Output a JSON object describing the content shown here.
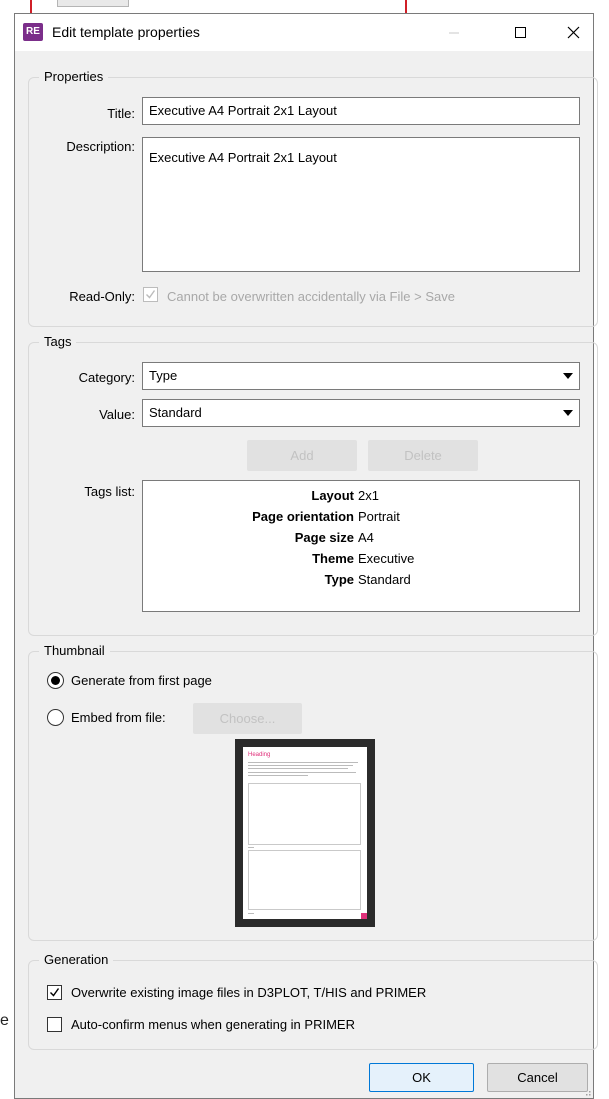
{
  "dialog": {
    "title": "Edit template properties",
    "app_icon_text": "RE",
    "controls": {
      "minimize": "minimize-icon",
      "maximize": "maximize-icon",
      "close": "close-icon"
    }
  },
  "background": {
    "partial_letter": "e"
  },
  "properties": {
    "legend": "Properties",
    "title_label": "Title:",
    "title_value": "Executive A4 Portrait 2x1 Layout",
    "description_label": "Description:",
    "description_value": "Executive A4 Portrait 2x1 Layout",
    "readonly_label": "Read-Only:",
    "readonly_checked": true,
    "readonly_text": "Cannot be overwritten accidentally via File > Save"
  },
  "tags": {
    "legend": "Tags",
    "category_label": "Category:",
    "category_value": "Type",
    "value_label": "Value:",
    "value_value": "Standard",
    "add_label": "Add",
    "delete_label": "Delete",
    "list_label": "Tags list:",
    "items": [
      {
        "key": "Layout",
        "value": "2x1"
      },
      {
        "key": "Page orientation",
        "value": "Portrait"
      },
      {
        "key": "Page size",
        "value": "A4"
      },
      {
        "key": "Theme",
        "value": "Executive"
      },
      {
        "key": "Type",
        "value": "Standard"
      }
    ]
  },
  "thumbnail": {
    "legend": "Thumbnail",
    "generate_label": "Generate from first page",
    "generate_selected": true,
    "embed_label": "Embed from file:",
    "choose_label": "Choose...",
    "preview_heading": "Heading"
  },
  "generation": {
    "legend": "Generation",
    "overwrite_label": "Overwrite existing image files in D3PLOT, T/HIS and PRIMER",
    "overwrite_checked": true,
    "autoconfirm_label": "Auto-confirm menus when generating in PRIMER",
    "autoconfirm_checked": false
  },
  "footer": {
    "ok_label": "OK",
    "cancel_label": "Cancel"
  },
  "colors": {
    "accent": "#0078d7",
    "brand": "#7b2e8a",
    "thumb_accent": "#e0307a"
  }
}
